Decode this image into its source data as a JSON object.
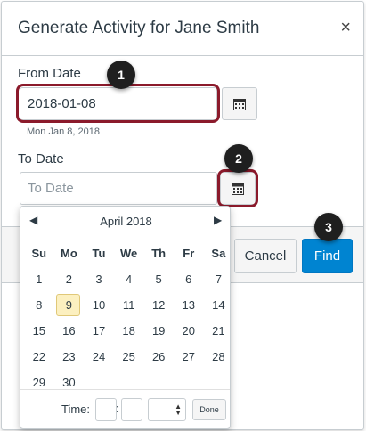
{
  "dialog": {
    "title": "Generate Activity for Jane Smith",
    "close_symbol": "×"
  },
  "from_date": {
    "label": "From Date",
    "value": "2018-01-08",
    "hint": "Mon Jan 8, 2018"
  },
  "to_date": {
    "label": "To Date",
    "placeholder": "To Date"
  },
  "buttons": {
    "cancel": "Cancel",
    "find": "Find"
  },
  "badges": [
    "1",
    "2",
    "3"
  ],
  "datepicker": {
    "month_label": "April 2018",
    "prev_symbol": "◀",
    "next_symbol": "▶",
    "weekdays": [
      "Su",
      "Mo",
      "Tu",
      "We",
      "Th",
      "Fr",
      "Sa"
    ],
    "weeks": [
      [
        "1",
        "2",
        "3",
        "4",
        "5",
        "6",
        "7"
      ],
      [
        "8",
        "9",
        "10",
        "11",
        "12",
        "13",
        "14"
      ],
      [
        "15",
        "16",
        "17",
        "18",
        "19",
        "20",
        "21"
      ],
      [
        "22",
        "23",
        "24",
        "25",
        "26",
        "27",
        "28"
      ],
      [
        "29",
        "30",
        "",
        "",
        "",
        "",
        ""
      ]
    ],
    "highlighted_day": "9",
    "time_label": "Time:",
    "time_colon": ":",
    "done_label": "Done"
  },
  "colors": {
    "highlight": "#8b1a2b",
    "primary": "#0084d1",
    "today_bg": "#fcf0c0"
  },
  "icons": {
    "calendar": "calendar-icon",
    "close": "close-icon"
  }
}
